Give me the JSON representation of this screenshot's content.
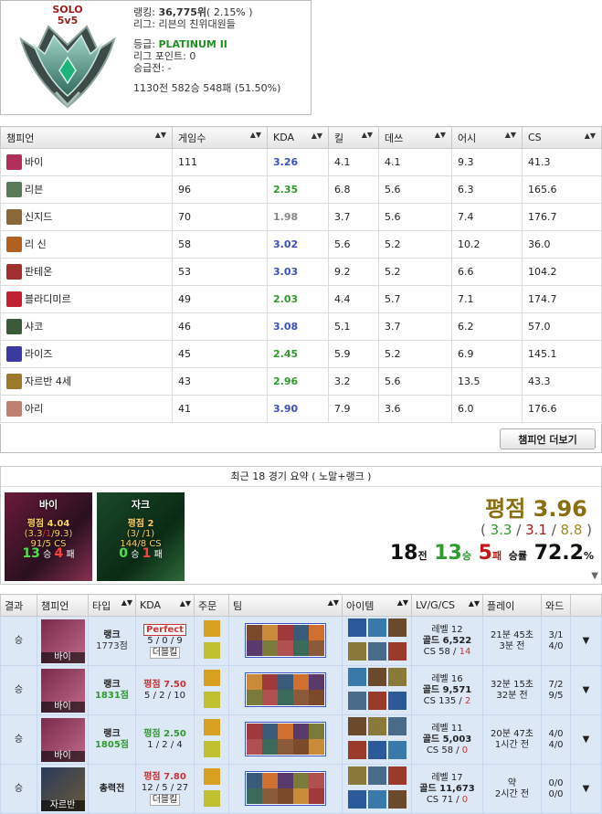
{
  "rank": {
    "queue": "SOLO",
    "mode": "5v5",
    "ranking_label": "랭킹:",
    "ranking_value": "36,775위",
    "ranking_pct": "( 2.15% )",
    "league_label": "리그:",
    "league_value": "리븐의 친위대원들",
    "tier_label": "등급:",
    "tier_value": "PLATINUM II",
    "lp_label": "리그 포인트:",
    "lp_value": "0",
    "promo_label": "승급전:",
    "promo_value": "-",
    "record": "1130전 582승 548패 (51.50%)"
  },
  "champ_table": {
    "headers": [
      "챔피언",
      "게임수",
      "KDA",
      "킬",
      "데쓰",
      "어시",
      "CS"
    ],
    "rows": [
      {
        "name": "바이",
        "games": "111",
        "kda": "3.26",
        "kda_color": "b",
        "k": "4.1",
        "d": "4.1",
        "a": "9.3",
        "cs": "41.3",
        "icon": "#b0305a"
      },
      {
        "name": "리븐",
        "games": "96",
        "kda": "2.35",
        "kda_color": "g",
        "k": "6.8",
        "d": "5.6",
        "a": "6.3",
        "cs": "165.6",
        "icon": "#5a7a5a"
      },
      {
        "name": "신지드",
        "games": "70",
        "kda": "1.98",
        "kda_color": "gr",
        "k": "3.7",
        "d": "5.6",
        "a": "7.4",
        "cs": "176.7",
        "icon": "#8a6a3a"
      },
      {
        "name": "리 신",
        "games": "58",
        "kda": "3.02",
        "kda_color": "b",
        "k": "5.6",
        "d": "5.2",
        "a": "10.2",
        "cs": "36.0",
        "icon": "#b06020"
      },
      {
        "name": "판테온",
        "games": "53",
        "kda": "3.03",
        "kda_color": "b",
        "k": "9.2",
        "d": "5.2",
        "a": "6.6",
        "cs": "104.2",
        "icon": "#a03030"
      },
      {
        "name": "블라디미르",
        "games": "49",
        "kda": "2.03",
        "kda_color": "g",
        "k": "4.4",
        "d": "5.7",
        "a": "7.1",
        "cs": "174.7",
        "icon": "#c02030"
      },
      {
        "name": "샤코",
        "games": "46",
        "kda": "3.08",
        "kda_color": "b",
        "k": "5.1",
        "d": "3.7",
        "a": "6.2",
        "cs": "57.0",
        "icon": "#3a5a3a"
      },
      {
        "name": "라이즈",
        "games": "45",
        "kda": "2.45",
        "kda_color": "g",
        "k": "5.9",
        "d": "5.2",
        "a": "6.9",
        "cs": "145.1",
        "icon": "#3a3aa0"
      },
      {
        "name": "자르반 4세",
        "games": "43",
        "kda": "2.96",
        "kda_color": "g",
        "k": "3.2",
        "d": "5.6",
        "a": "13.5",
        "cs": "43.3",
        "icon": "#9a7a2a"
      },
      {
        "name": "아리",
        "games": "41",
        "kda": "3.90",
        "kda_color": "b",
        "k": "7.9",
        "d": "3.6",
        "a": "6.0",
        "cs": "176.6",
        "icon": "#c08070"
      }
    ],
    "more_button": "챔피언 더보기"
  },
  "summary": {
    "title": "최근 18 경기 요약 ( 노말+랭크 )",
    "card1": {
      "name": "바이",
      "score": "평점 4.04",
      "kda_open": "(",
      "kda_k": "3.3",
      "kda_d": "/",
      "kda_d2": "1",
      "kda_a": "/9.3",
      "kda_close": ")",
      "cs": "91/5 CS",
      "wins": "13",
      "win_label": "승",
      "losses": "4",
      "loss_label": "패"
    },
    "card2": {
      "name": "자크",
      "score": "평점 2",
      "kda": "(3/ /1)",
      "cs": "144/8 CS",
      "wins": "0",
      "win_label": "승",
      "losses": "1",
      "loss_label": "패"
    },
    "score_label": "평점",
    "score_value": "3.96",
    "avg_k": "3.3",
    "avg_d": "3.1",
    "avg_a": "8.8",
    "games": "18",
    "games_label": "전",
    "wins": "13",
    "wins_label": "승",
    "losses": "5",
    "losses_label": "패",
    "rate_label": "승률",
    "rate": "72.2",
    "rate_unit": "%"
  },
  "match_table": {
    "headers": [
      "결과",
      "챔피언",
      "타입",
      "KDA",
      "주문",
      "팀",
      "아이템",
      "LV/G/CS",
      "플레이",
      "와드"
    ],
    "rows": [
      {
        "result": "승",
        "champ": "바이",
        "type": "랭크",
        "type_sub": "1773점",
        "kda_badge": "Perfect",
        "kda_score": "",
        "kda": "5 / 0 / 9",
        "kda_extra": "더블킬",
        "level": "레벨 12",
        "gold_label": "골드",
        "gold": "6,522",
        "cs": "CS 58 / ",
        "cs_red": "14",
        "play": "21분 45초",
        "ago": "3분 전",
        "ward1": "3/1",
        "ward2": "4/0"
      },
      {
        "result": "승",
        "champ": "바이",
        "type": "랭크",
        "type_sub": "1831점",
        "kda_badge": "",
        "kda_score": "평점 7.50",
        "kda": "5 / 2 / 10",
        "kda_extra": "",
        "level": "레벨 16",
        "gold_label": "골드",
        "gold": "9,571",
        "cs": "CS 135 / ",
        "cs_red": "2",
        "play": "32분 15초",
        "ago": "32분 전",
        "ward1": "7/2",
        "ward2": "9/5"
      },
      {
        "result": "승",
        "champ": "바이",
        "type": "랭크",
        "type_sub": "1805점",
        "kda_badge": "",
        "kda_score": "평점 2.50",
        "kda": "1 / 2 / 4",
        "kda_extra": "",
        "level": "레벨 11",
        "gold_label": "골드",
        "gold": "5,003",
        "cs": "CS 58 / ",
        "cs_red": "0",
        "play": "20분 47초",
        "ago": "1시간 전",
        "ward1": "4/0",
        "ward2": "4/0"
      },
      {
        "result": "승",
        "champ": "자르반",
        "type": "총력전",
        "type_sub": "",
        "kda_badge": "",
        "kda_score": "평점 7.80",
        "kda": "12 / 5 / 27",
        "kda_extra": "더블킬",
        "level": "레벨 17",
        "gold_label": "골드",
        "gold": "11,673",
        "cs": "CS 71 / ",
        "cs_red": "0",
        "play": "약",
        "ago": "2시간 전",
        "ward1": "0/0",
        "ward2": "0/0"
      }
    ]
  }
}
